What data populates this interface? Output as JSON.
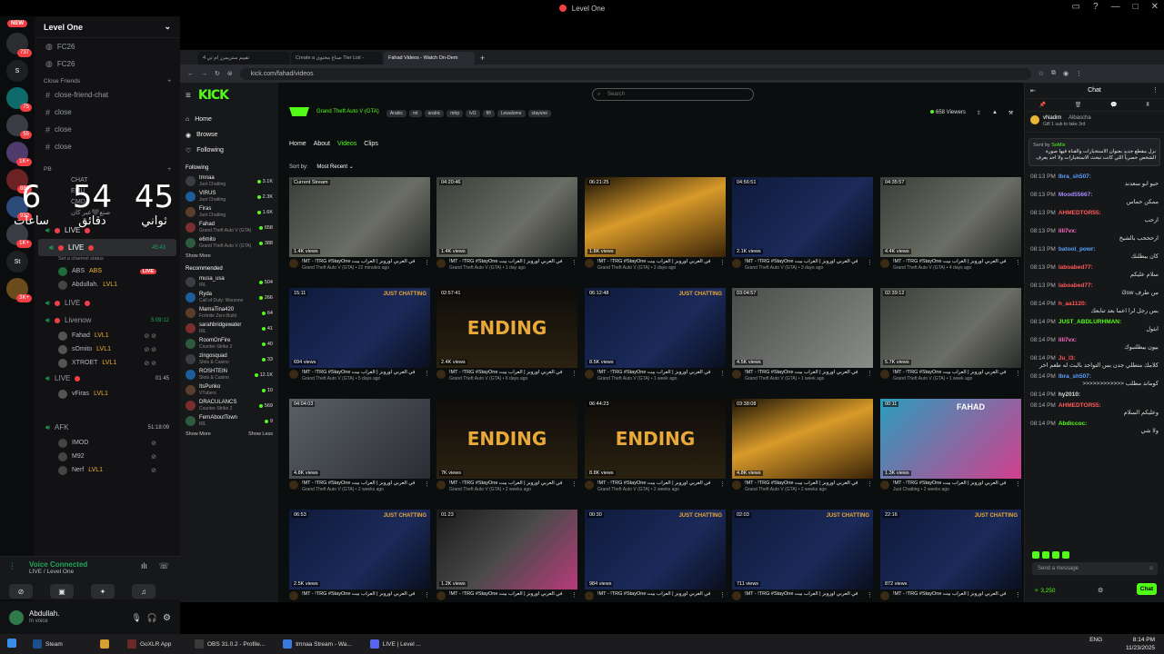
{
  "window": {
    "title": "Level One"
  },
  "rail": {
    "new_label": "NEW",
    "servers": [
      {
        "label": "",
        "badge": "737"
      },
      {
        "label": "S",
        "badge": ""
      },
      {
        "label": "",
        "badge": "75"
      },
      {
        "label": "",
        "badge": "55"
      },
      {
        "label": "",
        "badge": "1K+"
      },
      {
        "label": "",
        "badge": "884"
      },
      {
        "label": "",
        "badge": "932"
      },
      {
        "label": "",
        "badge": "1K+"
      },
      {
        "label": "St",
        "badge": ""
      },
      {
        "label": "",
        "badge": "3K+"
      }
    ]
  },
  "channels": {
    "server_name": "Level One",
    "top": [
      "FC26",
      "FC26"
    ],
    "cat_close_friends": "Close Friends",
    "close_friends": [
      "close-friend-chat",
      "close",
      "close",
      "close"
    ],
    "cat_pb": "PB",
    "pb": [
      "CHAT",
      "EMU",
      "CMD",
      "صتع🖤عبر كان"
    ],
    "live_channels": [
      {
        "label": "LIVE",
        "timer": ""
      },
      {
        "label": "LIVE",
        "timer": "45:43",
        "sub": "Set a channel status"
      }
    ],
    "vc_users_1": [
      {
        "name": "ABS",
        "extra": "ABS",
        "live": false
      },
      {
        "name": "Abdullah.",
        "extra": "LVL1",
        "live": true
      }
    ],
    "live_badge": "LIVE",
    "live3": "LIVE",
    "livenow": {
      "label": "Livenow",
      "timer": "5:09:12"
    },
    "vc_users_2": [
      "Fahad",
      "sOmito",
      "XTROET"
    ],
    "vc_tags_2": [
      "LVL1",
      "LVL1",
      "LVL1"
    ],
    "live4": {
      "label": "LIVE",
      "timer": "01 45"
    },
    "vc_users_3": [
      "vFiras"
    ],
    "afk": {
      "label": "AFK",
      "timer": "51:18:09"
    },
    "afk_users": [
      "IMOD",
      "M92",
      "Nerf"
    ],
    "afk_tag": "LVL1"
  },
  "clock": {
    "hours": "6",
    "minutes": "54",
    "seconds": "45",
    "hours_label": "ساعات",
    "minutes_label": "دقائق",
    "seconds_label": "ثواني"
  },
  "voice": {
    "status": "Voice Connected",
    "channel": "LIVE / Level One"
  },
  "user": {
    "name": "Abdullah.",
    "status": "In voice"
  },
  "browser": {
    "tabs": [
      "تقييم ستريمرز ام تي 4",
      "Create a صناع محتوى Tier List -",
      "Fahad Videos - Watch On-Dem"
    ],
    "url": "kick.com/fahad/videos"
  },
  "kick": {
    "logo": "KICK",
    "nav": [
      "Home",
      "Browse",
      "Following"
    ],
    "following_label": "Following",
    "following": [
      {
        "name": "tmnaa",
        "game": "Just Chatting",
        "count": "3.1K"
      },
      {
        "name": "VIRUS",
        "game": "Just Chatting",
        "count": "2.3K"
      },
      {
        "name": "Firas",
        "game": "Just Chatting",
        "count": "1.6K"
      },
      {
        "name": "Fahad",
        "game": "Grand Theft Auto V (GTA)",
        "count": "658"
      },
      {
        "name": "e6mito",
        "game": "Grand Theft Auto V (GTA)",
        "count": "388"
      }
    ],
    "show_more": "Show More",
    "recommended_label": "Recommended",
    "recommended": [
      {
        "name": "musa_usa",
        "game": "IRL",
        "count": "504"
      },
      {
        "name": "Ryda",
        "game": "Call of Duty: Warzone",
        "count": "266"
      },
      {
        "name": "MamaTina420",
        "game": "Fortnite Zero Build",
        "count": "64"
      },
      {
        "name": "sarahbridgewater",
        "game": "IRL",
        "count": "41"
      },
      {
        "name": "RoomOnFire",
        "game": "Counter-Strike 2",
        "count": "40"
      },
      {
        "name": "zingosquad",
        "game": "Slots & Casino",
        "count": "33"
      },
      {
        "name": "ROSHTEIN",
        "game": "Slots & Casino",
        "count": "12.1K"
      },
      {
        "name": "ItsPunko",
        "game": "VTubers",
        "count": "10"
      },
      {
        "name": "DRACULANCS",
        "game": "Counter-Strike 2",
        "count": "569"
      },
      {
        "name": "FernAboutTown",
        "game": "IRL",
        "count": "9"
      }
    ],
    "show_less": "Show Less",
    "search_placeholder": "Search",
    "category": "Grand Theft Auto V (GTA)",
    "tags": [
      "Arabic",
      "mt",
      "arabic",
      "mtrp",
      "lvl1",
      "fifi",
      "Lewalome",
      "stayone"
    ],
    "viewers": "658 Viewers",
    "tabs": [
      "Home",
      "About",
      "Videos",
      "Clips"
    ],
    "sort_label": "Sort by:",
    "sort_value": "Most Recent",
    "videos": [
      {
        "dur": "Current Stream",
        "views": "1.4K views",
        "title": "!MT - !TRG #StayOne في العربي أوروبز | العراب بيت",
        "sub": "Grand Theft Auto V (GTA) • 22 minutes ago",
        "thumb": "gta",
        "jc": false,
        "ending": false
      },
      {
        "dur": "04:20:46",
        "views": "1.4K views",
        "title": "!MT - !TRG #StayOne في العربي أوروبز | العراب بيت",
        "sub": "Grand Theft Auto V (GTA) • 1 day ago",
        "thumb": "gta",
        "jc": false,
        "ending": false
      },
      {
        "dur": "06:21:25",
        "views": "1.8K views",
        "title": "!MT - !TRG #StayOne في العربي أوروبز | العراب بيت",
        "sub": "Grand Theft Auto V (GTA) • 2 days ago",
        "thumb": "gold",
        "jc": false,
        "ending": false
      },
      {
        "dur": "04:56:51",
        "views": "2.1K views",
        "title": "!MT - !TRG #StayOne في العربي أوروبز | العراب بيت",
        "sub": "Grand Theft Auto V (GTA) • 3 days ago",
        "thumb": "cam",
        "jc": false,
        "ending": false
      },
      {
        "dur": "04:35:57",
        "views": "4.4K views",
        "title": "!MT - !TRG #StayOne في العربي أوروبز | العراب بيت",
        "sub": "Grand Theft Auto V (GTA) • 4 days ago",
        "thumb": "gta",
        "jc": false,
        "ending": false
      },
      {
        "dur": "15:11",
        "views": "694 views",
        "title": "!MT - !TRG #StayOne في العربي أوروبز | العراب بيت",
        "sub": "Grand Theft Auto V (GTA) • 5 days ago",
        "thumb": "cam",
        "jc": true,
        "ending": false
      },
      {
        "dur": "02:57:41",
        "views": "2.4K views",
        "title": "!MT - !TRG #StayOne في العربي أوروبز | العراب بيت",
        "sub": "Grand Theft Auto V (GTA) • 6 days ago",
        "thumb": "end",
        "jc": false,
        "ending": true
      },
      {
        "dur": "06:12:48",
        "views": "8.5K views",
        "title": "!MT - !TRG #StayOne في العربي أوروبز | العراب بيت",
        "sub": "Grand Theft Auto V (GTA) • 1 week ago",
        "thumb": "cam",
        "jc": true,
        "ending": false
      },
      {
        "dur": "03:04:57",
        "views": "4.5K views",
        "title": "!MT - !TRG #StayOne في العربي أوروبز | العراب بيت",
        "sub": "Grand Theft Auto V (GTA) • 1 week ago",
        "thumb": "car",
        "jc": false,
        "ending": false
      },
      {
        "dur": "02:39:12",
        "views": "5.7K views",
        "title": "!MT - !TRG #StayOne في العربي أوروبز | العراب بيت",
        "sub": "Grand Theft Auto V (GTA) • 1 week ago",
        "thumb": "gta",
        "jc": false,
        "ending": false
      },
      {
        "dur": "04:04:03",
        "views": "4.8K views",
        "title": "!MT - !TRG #StayOne في العربي أوروبز | العراب بيت",
        "sub": "Grand Theft Auto V (GTA) • 2 weeks ago",
        "thumb": "street",
        "jc": false,
        "ending": false
      },
      {
        "dur": "",
        "views": "7K views",
        "title": "!MT - !TRG #StayOne في العربي أوروبز | العراب بيت",
        "sub": "Grand Theft Auto V (GTA) • 2 weeks ago",
        "thumb": "end",
        "jc": false,
        "ending": true
      },
      {
        "dur": "06:44:23",
        "views": "8.8K views",
        "title": "!MT - !TRG #StayOne في العربي أوروبز | العراب بيت",
        "sub": "Grand Theft Auto V (GTA) • 2 weeks ago",
        "thumb": "end",
        "jc": false,
        "ending": true
      },
      {
        "dur": "03:38:08",
        "views": "4.8K views",
        "title": "!MT - !TRG #StayOne في العربي أوروبز | العراب بيت",
        "sub": "Grand Theft Auto V (GTA) • 2 weeks ago",
        "thumb": "gold",
        "jc": false,
        "ending": false
      },
      {
        "dur": "00:11",
        "views": "1.3K views",
        "title": "!MT - !TRG #StayOne في العربي أوروبز | العراب بيت",
        "sub": "Just Chatting • 2 weeks ago",
        "thumb": "fahad",
        "jc": false,
        "ending": false
      },
      {
        "dur": "06:53",
        "views": "2.5K views",
        "title": "!MT - !TRG #StayOne في العربي أوروبز | العراب بيت",
        "sub": "",
        "thumb": "cam",
        "jc": true,
        "ending": false
      },
      {
        "dur": "01:23",
        "views": "1.2K views",
        "title": "!MT - !TRG #StayOne في العربي أوروبز | العراب بيت",
        "sub": "",
        "thumb": "mix",
        "jc": false,
        "ending": false
      },
      {
        "dur": "00:30",
        "views": "984 views",
        "title": "!MT - !TRG #StayOne في العربي أوروبز | العراب بيت",
        "sub": "",
        "thumb": "cam",
        "jc": true,
        "ending": false
      },
      {
        "dur": "02:03",
        "views": "711 views",
        "title": "!MT - !TRG #StayOne في العربي أوروبز | العراب بيت",
        "sub": "",
        "thumb": "cam",
        "jc": true,
        "ending": false
      },
      {
        "dur": "22:16",
        "views": "872 views",
        "title": "!MT - !TRG #StayOne في العربي أوروبز | العراب بيت",
        "sub": "",
        "thumb": "cam",
        "jc": true,
        "ending": false
      }
    ],
    "ending_text": "ENDING",
    "just_chatting": "JUST CHATTING",
    "fahad_text": "FAHAD"
  },
  "chat": {
    "title": "Chat",
    "gift_user": "vNadim",
    "gift_to": "Albascha",
    "gift_text": "Gift 1 sub to take 3rd",
    "pinned_by": "Sent by",
    "pinned_user": "SoMix",
    "pinned_text": "نزل مقطع جديد بعنوان الاستخبارات والقناة فيها صورة الشخص حصرياً اللي كانت تبحث الاستخبارات ولا احد يعرف",
    "messages": [
      {
        "ts": "08:13 PM",
        "user": "Ibra_sh507:",
        "color": "#5aa0ff",
        "text": "حبو ابو سعدند"
      },
      {
        "ts": "08:13 PM",
        "user": "Mood55667:",
        "color": "#a78bfa",
        "text": "ممكن حماس"
      },
      {
        "ts": "08:13 PM",
        "user": "AHMEDTOR55:",
        "color": "#ff5a5a",
        "text": "ارحب"
      },
      {
        "ts": "08:13 PM",
        "user": "lili7vx:",
        "color": "#ff6ec7",
        "text": "ارحححب بالشيخ"
      },
      {
        "ts": "08:13 PM",
        "user": "batool_powr:",
        "color": "#5aa0ff",
        "text": "كان ببطلنك"
      },
      {
        "ts": "08:13 PM",
        "user": "laboabed77:",
        "color": "#ff5a5a",
        "text": "سلام عليكم"
      },
      {
        "ts": "08:13 PM",
        "user": "laboabed77:",
        "color": "#ff5a5a",
        "text": "من طرف i3sw"
      },
      {
        "ts": "08:14 PM",
        "user": "h_aa1120:",
        "color": "#ff5a5a",
        "text": "بس رجل لرا اعما بعد تنابعك"
      },
      {
        "ts": "08:14 PM",
        "user": "JUST_ABDLURHMAN:",
        "color": "#53fc18",
        "text": "ابثول"
      },
      {
        "ts": "08:14 PM",
        "user": "lili7vx:",
        "color": "#ff6ec7",
        "text": "بيون بيطلنبوك"
      },
      {
        "ts": "08:14 PM",
        "user": "Ju_l3:",
        "color": "#ff5a5a",
        "text": "كلامك متطلي جدن بس التواجد بالبث له طعم اخر"
      },
      {
        "ts": "08:14 PM",
        "user": "Ibra_sh507:",
        "color": "#5aa0ff",
        "text": "كوماند مطلب <<<<<<<<<<<<"
      },
      {
        "ts": "08:14 PM",
        "user": "hy2010:",
        "color": "#ddd",
        "text": ""
      },
      {
        "ts": "08:14 PM",
        "user": "AHMEDTOR55:",
        "color": "#ff5a5a",
        "text": "وعليكم السلام"
      },
      {
        "ts": "08:14 PM",
        "user": "Abdiccoc:",
        "color": "#53fc18",
        "text": "ولا شي"
      }
    ],
    "input_placeholder": "Send a message",
    "points": "3,250",
    "send_label": "Chat"
  },
  "taskbar": {
    "apps": [
      "Steam",
      "",
      "GoXLR App",
      "OBS 31.0.2 - Profile...",
      "tmnaa Stream - Wa...",
      "LIVE | Level ..."
    ],
    "lang": "ENG",
    "time": "8:14 PM",
    "date": "11/23/2025"
  }
}
